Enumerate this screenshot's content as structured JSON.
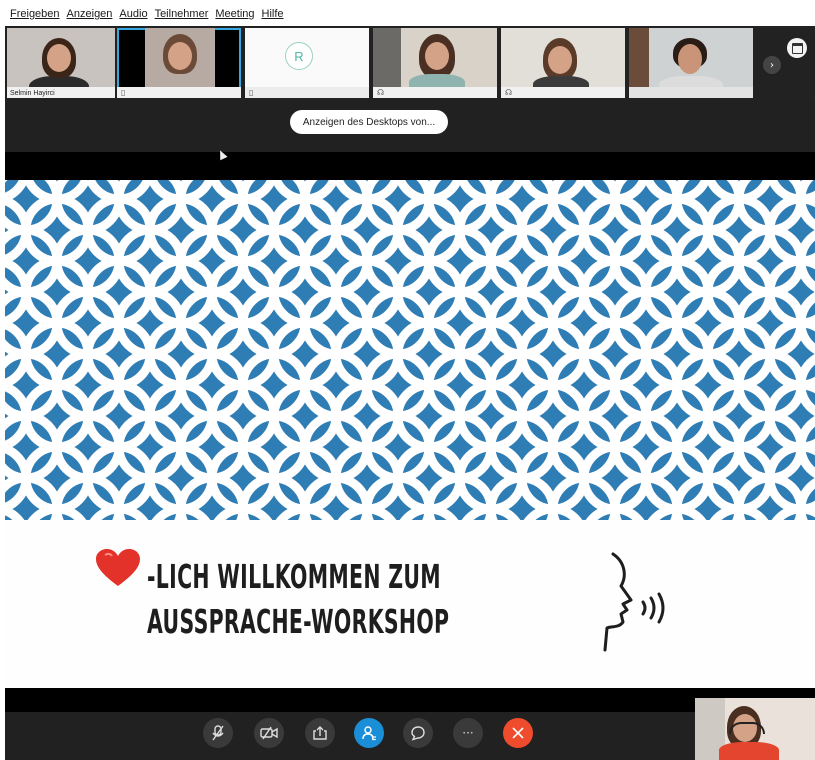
{
  "menu": {
    "items": [
      "Freigeben",
      "Anzeigen",
      "Audio",
      "Teilnehmer",
      "Meeting",
      "Hilfe"
    ]
  },
  "participants": [
    {
      "name": "Selmin Hayirci",
      "icon": "person-icon"
    },
    {
      "name": "",
      "icon": "device-icon",
      "selected": true
    },
    {
      "name": "",
      "icon": "device-icon",
      "avatar_letter": "R"
    },
    {
      "name": "",
      "icon": "headset-icon"
    },
    {
      "name": "",
      "icon": "headset-icon"
    },
    {
      "name": "",
      "icon": ""
    }
  ],
  "desktop_pill": "Anzeigen des Desktops von...",
  "slide": {
    "line1": "-LICH WILLKOMMEN ZUM",
    "line2": "AUSSPRACHE-WORKSHOP",
    "heart_icon": "heart-icon",
    "speaking_icon": "speaking-head-icon",
    "pattern_color": "#2f7db5"
  },
  "controls": [
    {
      "name": "mute-button",
      "icon": "muted-microphone-icon"
    },
    {
      "name": "video-button",
      "icon": "video-off-icon"
    },
    {
      "name": "share-button",
      "icon": "share-icon"
    },
    {
      "name": "participants-button",
      "icon": "participants-icon",
      "color": "#1a8fd8"
    },
    {
      "name": "chat-button",
      "icon": "chat-icon"
    },
    {
      "name": "more-button",
      "icon": "more-icon",
      "label": "···"
    },
    {
      "name": "leave-button",
      "icon": "close-icon",
      "color": "#ef4b2d"
    }
  ]
}
